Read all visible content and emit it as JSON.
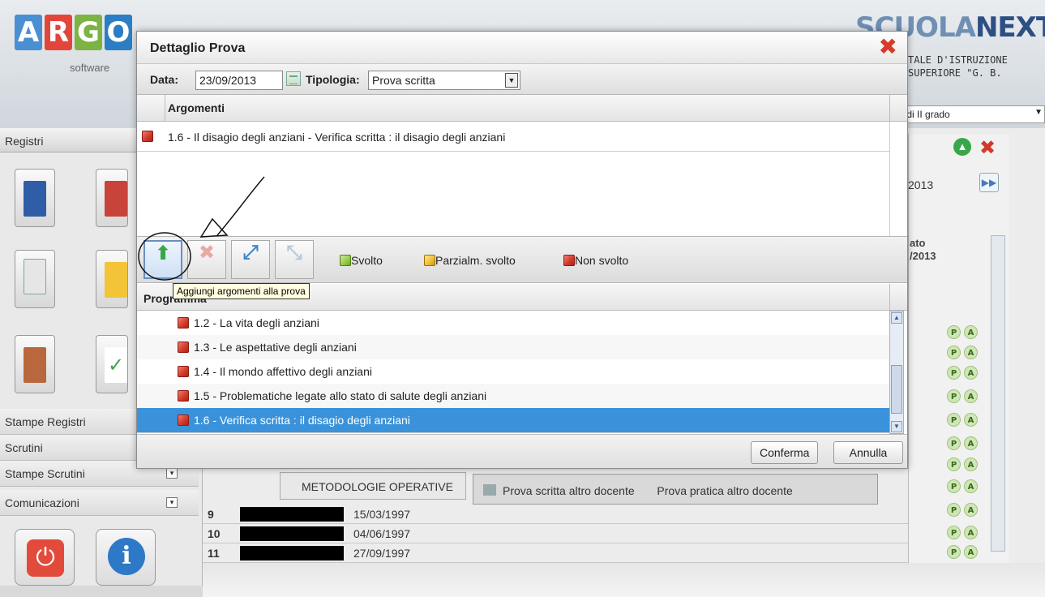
{
  "header": {
    "logo_letters": [
      "A",
      "R",
      "G",
      "O"
    ],
    "logo_colors": [
      "#4a8fd1",
      "#e4453a",
      "#7cb342",
      "#2c7ec4"
    ],
    "logo_sub": "software",
    "brand_a": "SCUOLA",
    "brand_b": "NEXT",
    "school_line1": "TALE D'ISTRUZIONE",
    "school_line2": "SUPERIORE \"G. B.",
    "school_select": "aria di II grado"
  },
  "sidebar": {
    "title": "Registri",
    "menu": [
      "Stampe Registri",
      "Scrutini",
      "Stampe Scrutini",
      "Comunicazioni"
    ]
  },
  "right_panel": {
    "date": "2013",
    "col_line1": "ato",
    "col_line2": "/2013",
    "p_label": "P",
    "a_label": "A"
  },
  "background": {
    "tab_metodologie": "METODOLOGIE OPERATIVE",
    "tab_prova_scritta": "Prova scritta altro docente",
    "tab_prova_pratica": "Prova pratica altro docente",
    "students": [
      {
        "num": "9",
        "date": "15/03/1997"
      },
      {
        "num": "10",
        "date": "04/06/1997"
      },
      {
        "num": "11",
        "date": "27/09/1997"
      }
    ]
  },
  "modal": {
    "title": "Dettaglio Prova",
    "data_label": "Data:",
    "data_value": "23/09/2013",
    "tipologia_label": "Tipologia:",
    "tipologia_value": "Prova scritta",
    "argomenti_header": "Argomenti",
    "argomenti": [
      {
        "text": "1.6 - Il disagio degli anziani - Verifica scritta : il disagio degli anziani",
        "status": "red"
      }
    ],
    "legend": {
      "svolto": "Svolto",
      "parzialm": "Parzialm. svolto",
      "non_svolto": "Non svolto"
    },
    "tooltip": "Aggiungi argomenti alla prova",
    "programma_header": "Programma",
    "programma": [
      {
        "text": "1.2 - La vita degli anziani",
        "status": "red"
      },
      {
        "text": "1.3 - Le aspettative degli anziani",
        "status": "red"
      },
      {
        "text": "1.4 - Il mondo affettivo degli anziani",
        "status": "red"
      },
      {
        "text": "1.5 - Problematiche legate allo stato di salute degli anziani",
        "status": "red"
      },
      {
        "text": "1.6 - Verifica scritta : il disagio degli anziani",
        "status": "red",
        "selected": true
      }
    ],
    "confirm_label": "Conferma",
    "cancel_label": "Annulla"
  },
  "colors": {
    "selection": "#3a93da",
    "close_red": "#d83a2b",
    "status_red": "#d43a2a",
    "status_yellow": "#f1c23a",
    "status_green": "#99cc4c"
  }
}
